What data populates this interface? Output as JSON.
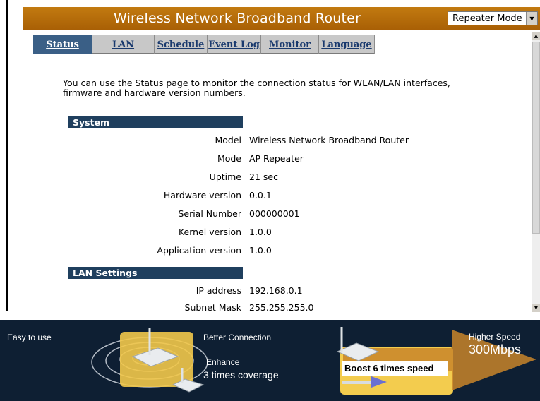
{
  "header": {
    "title": "Wireless Network Broadband Router",
    "mode_select_value": "Repeater Mode"
  },
  "tabs": [
    {
      "label": "Status"
    },
    {
      "label": "LAN"
    },
    {
      "label": "Schedule"
    },
    {
      "label": "Event Log"
    },
    {
      "label": "Monitor"
    },
    {
      "label": "Language"
    }
  ],
  "intro": "You can use the Status page to monitor the connection status for WLAN/LAN interfaces, firmware and hardware version numbers.",
  "system": {
    "heading": "System",
    "rows": [
      {
        "label": "Model",
        "value": "Wireless Network Broadband Router"
      },
      {
        "label": "Mode",
        "value": "AP Repeater"
      },
      {
        "label": "Uptime",
        "value": "21 sec"
      },
      {
        "label": "Hardware version",
        "value": "0.0.1"
      },
      {
        "label": "Serial Number",
        "value": "000000001"
      },
      {
        "label": "Kernel version",
        "value": "1.0.0"
      },
      {
        "label": "Application version",
        "value": "1.0.0"
      }
    ]
  },
  "lan": {
    "heading": "LAN Settings",
    "rows": [
      {
        "label": "IP address",
        "value": "192.168.0.1"
      },
      {
        "label": "Subnet Mask",
        "value": "255.255.255.0"
      }
    ]
  },
  "banner": {
    "easy": "Easy to use",
    "better": "Better Connection",
    "enhance": "Enhance",
    "coverage": "3 times coverage",
    "boost": "Boost 6 times speed",
    "higher": "Higher Speed",
    "speed": "300Mbps"
  },
  "colors": {
    "title_bar": "#b06a0a",
    "tab_active": "#3a5f86",
    "section_header": "#1f3f5e",
    "banner_bg": "#0e1f33"
  }
}
